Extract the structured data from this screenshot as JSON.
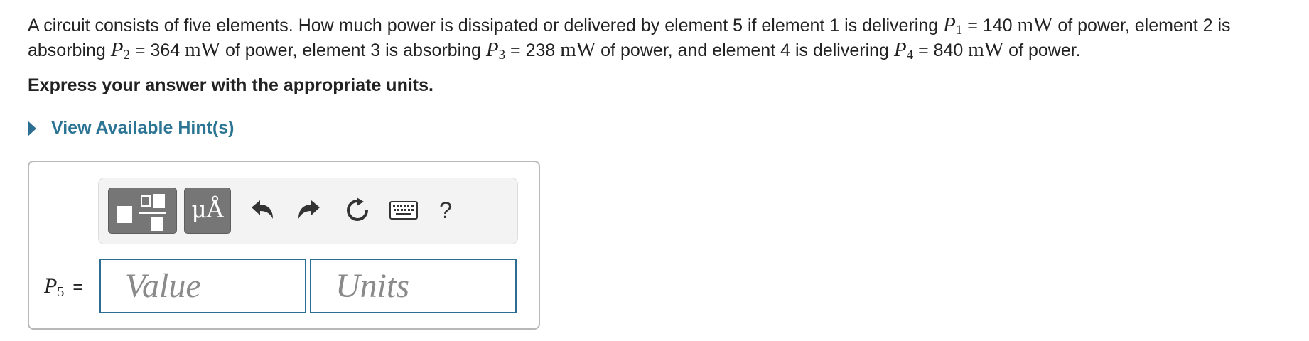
{
  "problem": {
    "intro": "A circuit consists of five elements. How much power is dissipated or delivered by element 5 if element 1 is delivering ",
    "p1_sym": "P",
    "p1_sub": "1",
    "p1_val": " = 140 ",
    "p1_unit": "mW",
    "mid1": " of power, element 2 is absorbing ",
    "p2_sym": "P",
    "p2_sub": "2",
    "p2_val": " = 364 ",
    "p2_unit": "mW",
    "mid2": " of power, element 3 is absorbing ",
    "p3_sym": "P",
    "p3_sub": "3",
    "p3_val": " = 238 ",
    "p3_unit": "mW",
    "mid3": " of power, and element 4 is delivering ",
    "p4_sym": "P",
    "p4_sub": "4",
    "p4_val": " = 840 ",
    "p4_unit": "mW",
    "end": " of power."
  },
  "instruction": "Express your answer with the appropriate units.",
  "hint_label": "View Available Hint(s)",
  "toolbar": {
    "units_label": "μÅ",
    "help_label": "?"
  },
  "answer": {
    "label_sym": "P",
    "label_sub": "5",
    "equals": "=",
    "value_placeholder": "Value",
    "units_placeholder": "Units"
  },
  "colors": {
    "link": "#2c7494",
    "field_border": "#2c6e91",
    "toolbar_button": "#767676"
  }
}
